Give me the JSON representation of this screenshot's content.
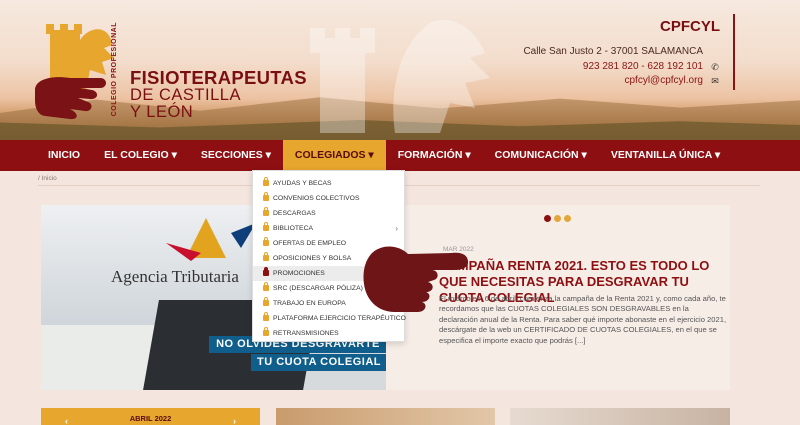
{
  "header": {
    "college_vertical": "COLEGIO PROFESIONAL",
    "brand_line1": "FISIOTERAPEUTAS",
    "brand_line2": "DE CASTILLA",
    "brand_line3": "Y LEÓN",
    "org": "CPFCYL",
    "address": "Calle San Justo 2 - 37001 SALAMANCA",
    "phones": "923 281 820 - 628 192 101",
    "email": "cpfcyl@cpfcyl.org",
    "icons": {
      "phone": "phone-icon",
      "email": "envelope-icon"
    },
    "colors": {
      "brand": "#8d0f12",
      "accent": "#e7a62d"
    }
  },
  "nav": {
    "items": [
      {
        "label": "INICIO"
      },
      {
        "label": "EL COLEGIO ▾"
      },
      {
        "label": "SECCIONES ▾"
      },
      {
        "label": "COLEGIADOS ▾"
      },
      {
        "label": "FORMACIÓN ▾"
      },
      {
        "label": "COMUNICACIÓN ▾"
      },
      {
        "label": "VENTANILLA ÚNICA ▾"
      }
    ],
    "active": "COLEGIADOS"
  },
  "breadcrumb": "/ Inicio",
  "dropdown": {
    "items": [
      {
        "label": "AYUDAS Y BECAS"
      },
      {
        "label": "CONVENIOS COLECTIVOS"
      },
      {
        "label": "DESCARGAS"
      },
      {
        "label": "BIBLIOTECA"
      },
      {
        "label": "OFERTAS DE EMPLEO"
      },
      {
        "label": "OPOSICIONES Y BOLSA"
      },
      {
        "label": "PROMOCIONES"
      },
      {
        "label": "SRC (DESCARGAR PÓLIZA)"
      },
      {
        "label": "TRABAJO EN EUROPA"
      },
      {
        "label": "PLATAFORMA EJERCICIO TERAPÉUTICO"
      },
      {
        "label": "RETRANSMISIONES"
      }
    ],
    "highlighted": "PROMOCIONES"
  },
  "slider": {
    "image_text": "Agencia Tributaria",
    "banner_line1": "NO OLVIDES DESGRAVARTE",
    "banner_line2": "TU CUOTA COLEGIAL",
    "post_date": "MAR 2022",
    "post_title": "CAMPAÑA RENTA 2021. ESTO ES TODO LO QUE NECESITAS PARA DESGRAVAR TU CUOTA COLEGIAL",
    "post_excerpt": "El miércoles, 6 de abril, comienza la campaña de la Renta 2021 y, como cada año, te recordamos que las CUOTAS COLEGIALES SON DESGRAVABLES en la declaración anual de la Renta. Para saber qué importe abonaste en el ejercicio 2021, descárgate de la web un CERTIFICADO DE CUOTAS COLEGIALES, en el que se especifica el importe exacto que podrás [...]"
  },
  "calendar": {
    "month": "ABRIL 2022"
  }
}
